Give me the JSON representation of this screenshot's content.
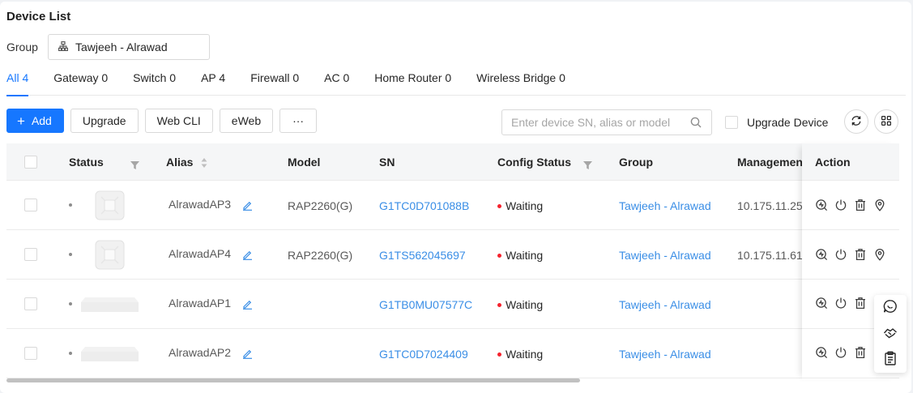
{
  "page": {
    "title": "Device List",
    "group_label": "Group",
    "group_value": "Tawjeeh - Alrawad"
  },
  "tabs": [
    {
      "label": "All 4"
    },
    {
      "label": "Gateway 0"
    },
    {
      "label": "Switch 0"
    },
    {
      "label": "AP 4"
    },
    {
      "label": "Firewall 0"
    },
    {
      "label": "AC 0"
    },
    {
      "label": "Home Router 0"
    },
    {
      "label": "Wireless Bridge 0"
    }
  ],
  "toolbar": {
    "add_label": "Add",
    "upgrade_label": "Upgrade",
    "webcli_label": "Web CLI",
    "eweb_label": "eWeb",
    "more_label": "···",
    "search_placeholder": "Enter device SN, alias or model",
    "upgrade_device_label": "Upgrade Device"
  },
  "columns": {
    "status": "Status",
    "alias": "Alias",
    "model": "Model",
    "sn": "SN",
    "config_status": "Config Status",
    "group": "Group",
    "management": "Managemen",
    "action": "Action"
  },
  "rows": [
    {
      "alias": "AlrawadAP3",
      "model": "RAP2260(G)",
      "sn": "G1TC0D701088B",
      "config_status": "Waiting",
      "group": "Tawjeeh - Alrawad",
      "management": "10.175.11.25"
    },
    {
      "alias": "AlrawadAP4",
      "model": "RAP2260(G)",
      "sn": "G1TS562045697",
      "config_status": "Waiting",
      "group": "Tawjeeh - Alrawad",
      "management": "10.175.11.61"
    },
    {
      "alias": "AlrawadAP1",
      "model": "",
      "sn": "G1TB0MU07577C",
      "config_status": "Waiting",
      "group": "Tawjeeh - Alrawad",
      "management": ""
    },
    {
      "alias": "AlrawadAP2",
      "model": "",
      "sn": "G1TC0D7024409",
      "config_status": "Waiting",
      "group": "Tawjeeh - Alrawad",
      "management": ""
    }
  ],
  "colors": {
    "primary": "#1677ff",
    "link": "#3a8ee6",
    "status_waiting": "#f5222d"
  }
}
